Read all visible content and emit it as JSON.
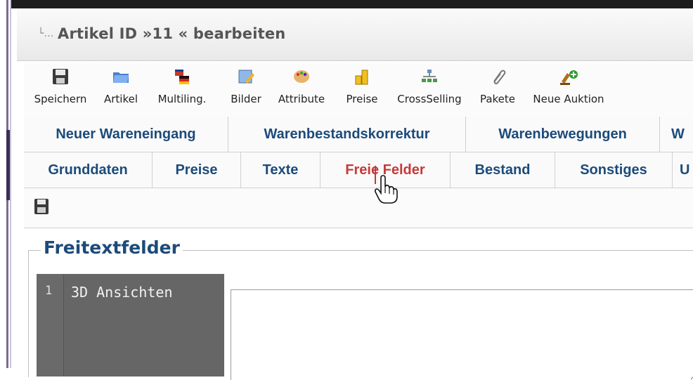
{
  "window": {
    "title": "Artikel ID »11 « bearbeiten",
    "tree_glyph": "└…"
  },
  "toolbar": [
    {
      "label": "Speichern",
      "icon": "floppy-disk-icon"
    },
    {
      "label": "Artikel",
      "icon": "folder-icon"
    },
    {
      "label": "Multiling.",
      "icon": "flags-icon"
    },
    {
      "label": "Bilder",
      "icon": "image-edit-icon"
    },
    {
      "label": "Attribute",
      "icon": "palette-icon"
    },
    {
      "label": "Preise",
      "icon": "coins-icon"
    },
    {
      "label": "CrossSelling",
      "icon": "sitemap-icon"
    },
    {
      "label": "Pakete",
      "icon": "paperclip-icon"
    },
    {
      "label": "Neue Auktion",
      "icon": "gavel-plus-icon"
    }
  ],
  "stock_tabs": [
    "Neuer Wareneingang",
    "Warenbestandskorrektur",
    "Warenbewegungen",
    "W"
  ],
  "article_tabs": [
    "Grunddaten",
    "Preise",
    "Texte",
    "Freie Felder",
    "Bestand",
    "Sonstiges",
    "U"
  ],
  "active_tab": "Freie Felder",
  "fieldset": {
    "legend": "Freitextfelder",
    "rows": [
      {
        "number": "1",
        "name": "3D Ansichten",
        "value": ""
      }
    ]
  },
  "colors": {
    "tab_text": "#1c4b7a",
    "active_tab_text": "#c43a3a",
    "legend": "#1c4b7a",
    "code_gutter": "#666666"
  }
}
